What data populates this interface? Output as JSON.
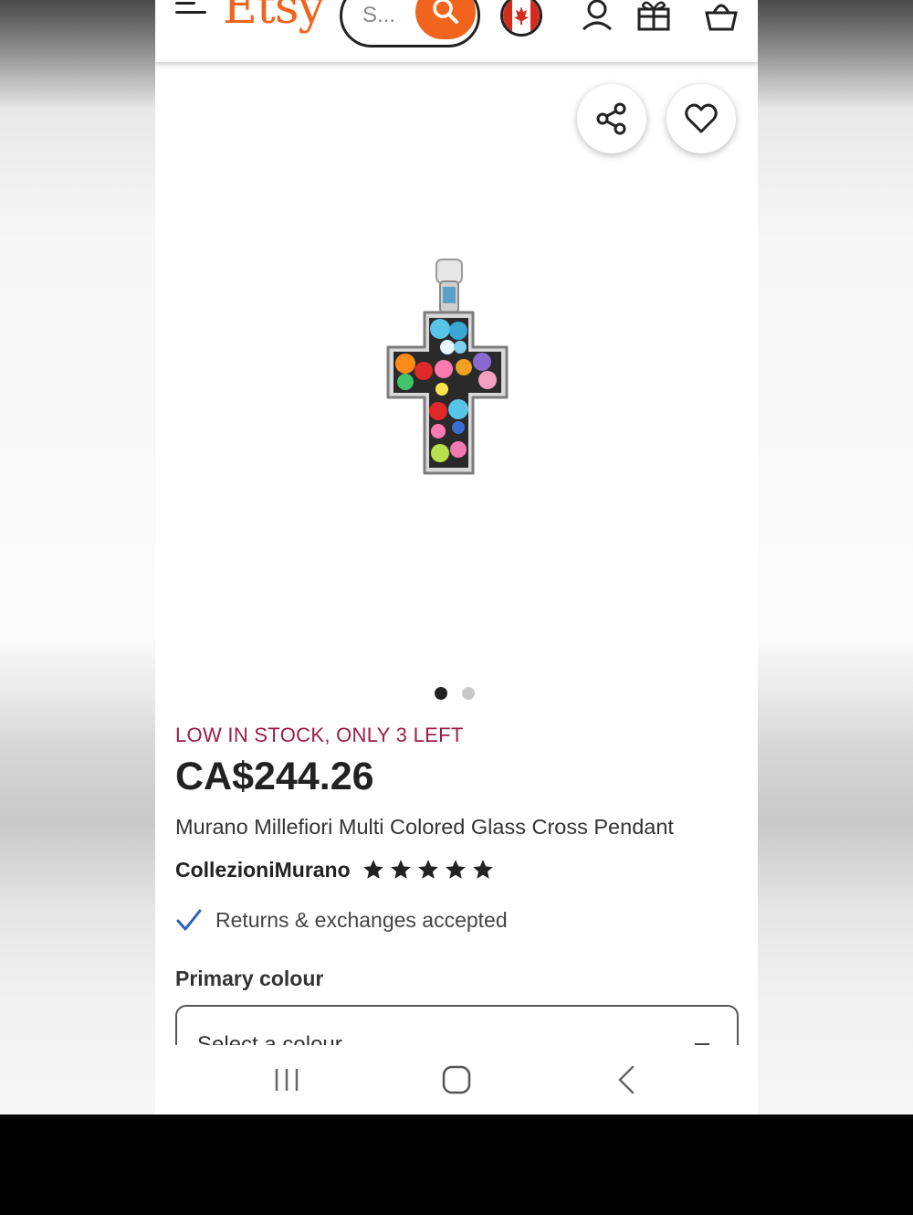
{
  "header": {
    "logo": "Etsy",
    "search_placeholder": "S...",
    "icons": [
      "menu-icon",
      "search-icon",
      "canada-flag-icon",
      "account-icon",
      "gift-icon",
      "basket-icon"
    ]
  },
  "product": {
    "stock_notice": "LOW IN STOCK, ONLY 3 LEFT",
    "price": "CA$244.26",
    "title": "Murano Millefiori Multi Colored Glass Cross Pendant",
    "shop_name": "CollezioniMurano",
    "rating_stars": 5,
    "returns_text": "Returns & exchanges accepted",
    "image_count": 2,
    "current_image": 1
  },
  "options": {
    "colour_label": "Primary colour",
    "colour_select_placeholder": "Select a colour"
  },
  "colors": {
    "accent": "#f1641e",
    "stock_text": "#9b1d46",
    "check": "#2f5fb3"
  }
}
